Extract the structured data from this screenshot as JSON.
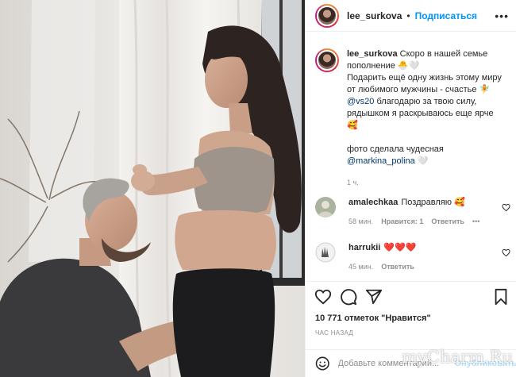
{
  "header": {
    "username": "lee_surkova",
    "separator": "•",
    "follow_label": "Подписаться",
    "more_label": "•••"
  },
  "caption": {
    "username": "lee_surkova",
    "line1": "Скоро в нашей семье пополнение 🐣🤍",
    "line2": "Подарить ещё одну жизнь этому миру от любимого мужчины - счастье 🧚",
    "mention1": "@vs20",
    "line3": " благодарю за твою силу, рядышком я раскрываюсь еще ярче 🥰",
    "line4": "фото сделала чудесная",
    "mention2": "@markina_polina",
    "line4_end": " 🤍",
    "time": "1 ч."
  },
  "comments": [
    {
      "username": "amalechkaa",
      "text": "Поздравляю 🥰",
      "time": "58 мин.",
      "likes": "Нравится: 1",
      "reply": "Ответить",
      "more": "•••"
    },
    {
      "username": "harrukii",
      "text": "❤️❤️❤️",
      "time": "45 мин.",
      "reply": "Ответить"
    }
  ],
  "actions": {
    "like_icon": "heart-icon",
    "comment_icon": "comment-icon",
    "share_icon": "send-icon",
    "save_icon": "bookmark-icon"
  },
  "likes_text": "10 771 отметок \"Нравится\"",
  "post_age": "ЧАС НАЗАД",
  "add_comment": {
    "placeholder": "Добавьте комментарий...",
    "publish_label": "Опубликовать"
  },
  "watermark": "myCharm.Ru",
  "colors": {
    "link": "#0095f6",
    "mention": "#00376b",
    "muted": "#8e8e8e",
    "publish_disabled": "#b2dffc"
  }
}
